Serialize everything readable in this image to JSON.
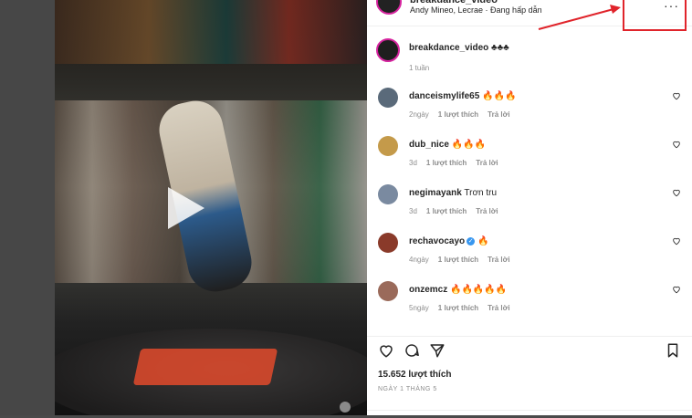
{
  "post": {
    "author": "breakdance_video",
    "subtitle": "Andy Mineo, Lecrae · Đang hấp dẫn",
    "caption_user": "breakdance_video",
    "caption_emojis": "♣♣♣",
    "caption_time": "1 tuần",
    "more_label": "···"
  },
  "comments": [
    {
      "user": "danceismylife65",
      "text": "🔥🔥🔥",
      "time": "2ngày",
      "likes": "1 lượt thích",
      "reply": "Trả lời",
      "verified": false,
      "avatar_color": "#5a6a7a"
    },
    {
      "user": "dub_nice",
      "text": "🔥🔥🔥",
      "time": "3d",
      "likes": "1 lượt thích",
      "reply": "Trả lời",
      "verified": false,
      "avatar_color": "#c49a4a"
    },
    {
      "user": "negimayank",
      "text": "Trơn tru",
      "time": "3d",
      "likes": "1 lượt thích",
      "reply": "Trả lời",
      "verified": false,
      "avatar_color": "#7a8aa0"
    },
    {
      "user": "rechavocayo",
      "text": "🔥",
      "time": "4ngày",
      "likes": "1 lượt thích",
      "reply": "Trả lời",
      "verified": true,
      "avatar_color": "#8a3a2a"
    },
    {
      "user": "onzemcz",
      "text": "🔥🔥🔥🔥🔥",
      "time": "5ngày",
      "likes": "1 lượt thích",
      "reply": "Trả lời",
      "verified": false,
      "avatar_color": "#9a6a5a"
    }
  ],
  "footer": {
    "likes": "15.652 lượt thích",
    "date": "NGÀY 1 THÁNG 5"
  },
  "colors": {
    "highlight": "#e0242b",
    "ring": "#d6249f"
  }
}
